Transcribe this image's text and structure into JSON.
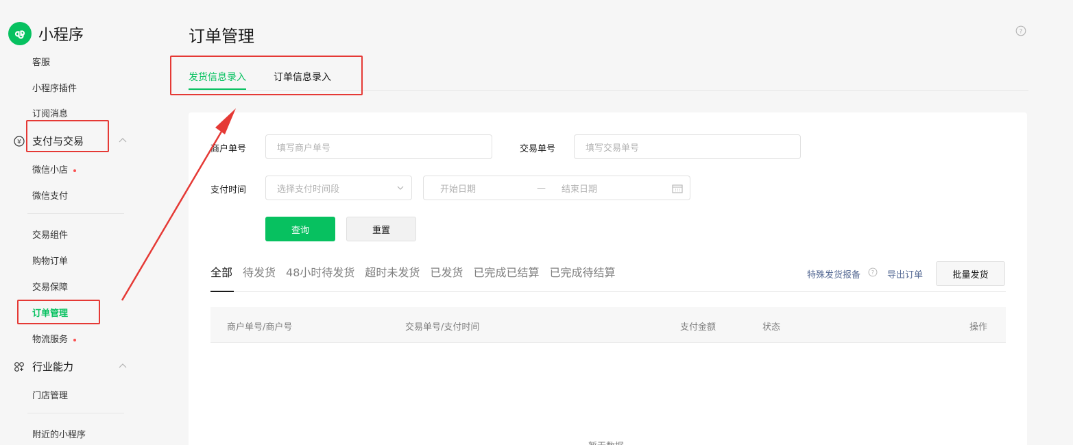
{
  "brand": {
    "name": "小程序"
  },
  "sidebar": {
    "items_top": [
      {
        "label": "客服"
      },
      {
        "label": "小程序插件"
      },
      {
        "label": "订阅消息"
      }
    ],
    "groups": [
      {
        "label": "支付与交易",
        "icon": "yuan-circle-icon",
        "items": [
          {
            "label": "微信小店",
            "badge": true
          },
          {
            "label": "微信支付",
            "badge": false
          },
          {
            "label": "交易组件",
            "badge": false
          },
          {
            "label": "购物订单",
            "badge": false
          },
          {
            "label": "交易保障",
            "badge": false
          },
          {
            "label": "订单管理",
            "badge": false,
            "active": true
          },
          {
            "label": "物流服务",
            "badge": true
          }
        ]
      },
      {
        "label": "行业能力",
        "icon": "industry-icon",
        "items": [
          {
            "label": "门店管理"
          },
          {
            "label": "附近的小程序"
          }
        ]
      }
    ]
  },
  "page": {
    "title": "订单管理"
  },
  "top_tabs": [
    {
      "label": "发货信息录入",
      "active": true
    },
    {
      "label": "订单信息录入",
      "active": false
    }
  ],
  "filters": {
    "merchant_no": {
      "label": "商户单号",
      "placeholder": "填写商户单号"
    },
    "trade_no": {
      "label": "交易单号",
      "placeholder": "填写交易单号"
    },
    "pay_time": {
      "label": "支付时间",
      "select_placeholder": "选择支付时间段",
      "start": "开始日期",
      "separator": "—",
      "end": "结束日期"
    },
    "query_button": "查询",
    "reset_button": "重置"
  },
  "status_tabs": [
    {
      "label": "全部",
      "active": true
    },
    {
      "label": "待发货"
    },
    {
      "label": "48小时待发货"
    },
    {
      "label": "超时未发货"
    },
    {
      "label": "已发货"
    },
    {
      "label": "已完成已结算"
    },
    {
      "label": "已完成待结算"
    }
  ],
  "actions": {
    "special_report": "特殊发货报备",
    "export": "导出订单",
    "batch_ship": "批量发货"
  },
  "table": {
    "columns": [
      "商户单号/商户号",
      "交易单号/支付时间",
      "支付金额",
      "状态",
      "操作"
    ],
    "empty_text": "暂无数据"
  },
  "colors": {
    "accent": "#07c160",
    "link": "#576b95",
    "annotation": "#e53935"
  }
}
